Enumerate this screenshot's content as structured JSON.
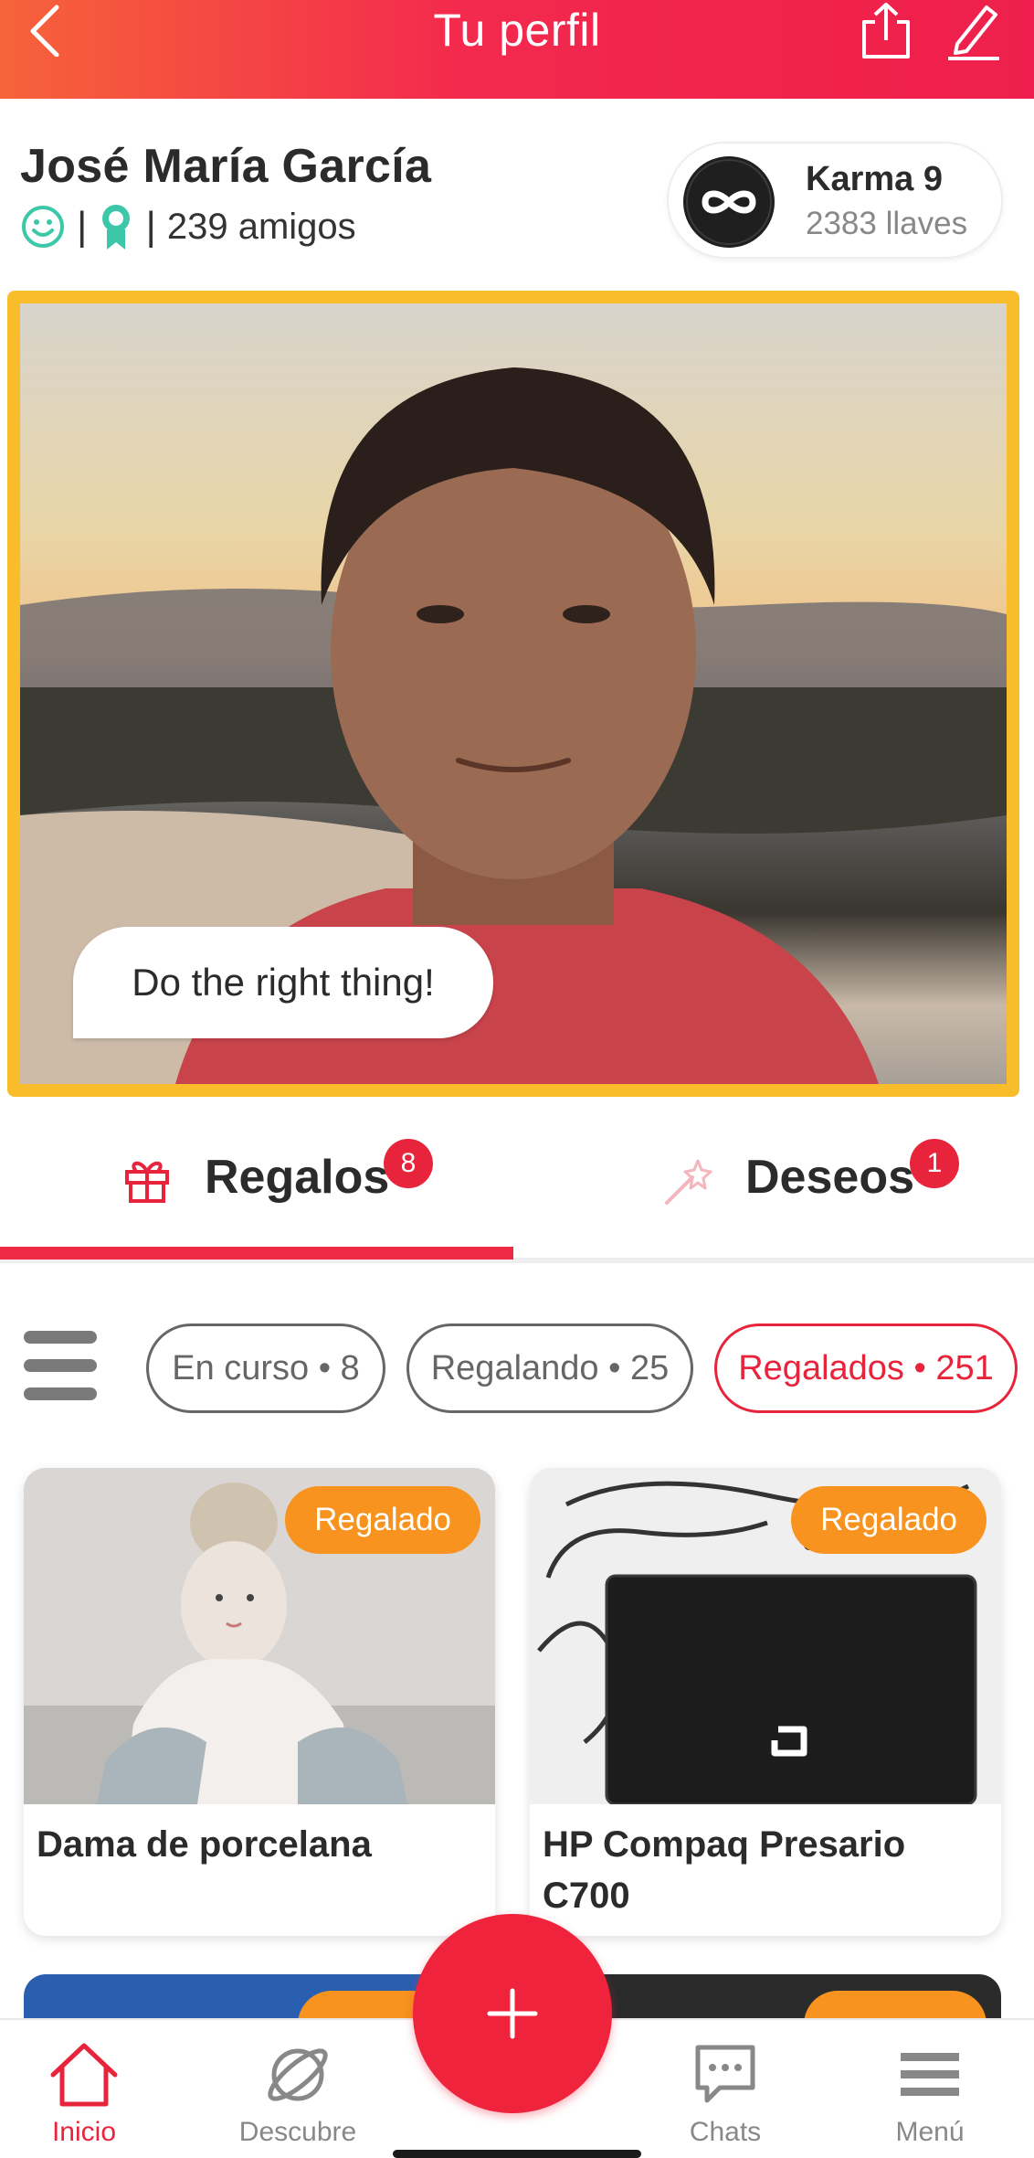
{
  "header": {
    "title": "Tu perfil",
    "back_icon": "chevron-left-icon",
    "share_icon": "share-icon",
    "edit_icon": "pencil-icon"
  },
  "profile": {
    "name": "José María García",
    "friends": "239 amigos",
    "separator": "|",
    "karma": {
      "title": "Karma 9",
      "keys": "2383 llaves"
    },
    "motto": "Do the right thing!"
  },
  "tabs": [
    {
      "label": "Regalos",
      "badge": "8",
      "icon": "gift-icon",
      "active": true
    },
    {
      "label": "Deseos",
      "badge": "1",
      "icon": "magic-wand-icon",
      "active": false
    }
  ],
  "filters": [
    {
      "label": "En curso • 8",
      "active": false
    },
    {
      "label": "Regalando • 25",
      "active": false
    },
    {
      "label": "Regalados • 251",
      "active": true
    }
  ],
  "items": [
    {
      "title": "Dama de porcelana",
      "status": "Regalado"
    },
    {
      "title": "HP Compaq Presario C700",
      "status": "Regalado"
    }
  ],
  "nav": [
    {
      "label": "Inicio",
      "icon": "home-icon",
      "active": true
    },
    {
      "label": "Descubre",
      "icon": "planet-icon",
      "active": false
    },
    {
      "label": "Chats",
      "icon": "chat-icon",
      "active": false
    },
    {
      "label": "Menú",
      "icon": "menu-icon",
      "active": false
    }
  ],
  "colors": {
    "brand_red": "#ee2a44",
    "header_gradient_start": "#f6633a",
    "header_gradient_end": "#ee1f4c",
    "badge_orange": "#f7931e",
    "photo_border_yellow": "#f9bd2b",
    "teal_icons": "#3cc8a8"
  }
}
